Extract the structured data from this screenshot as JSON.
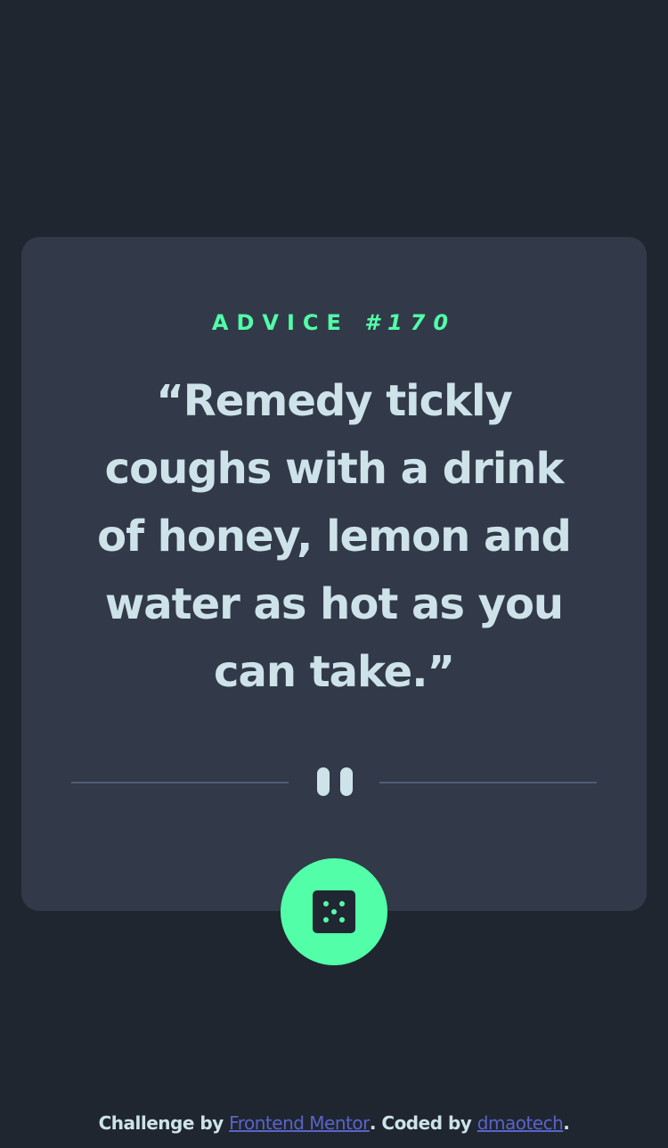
{
  "advice": {
    "label": "ADVICE ",
    "number": "#170",
    "quote": "“Remedy tickly coughs with a drink of honey, lemon and water as hot as you can take.”"
  },
  "divider": {
    "icon": "pause-icon"
  },
  "dice_button": {
    "icon": "dice-icon"
  },
  "footer": {
    "prefix": "Challenge by ",
    "link1": "Frontend Mentor",
    "middle": ". Coded by ",
    "link2": "dmaotech",
    "suffix": "."
  },
  "colors": {
    "background": "#1f2630",
    "card": "#323a49",
    "accent": "#52ffa8",
    "text": "#cee3e9",
    "link": "#5a64c8"
  }
}
